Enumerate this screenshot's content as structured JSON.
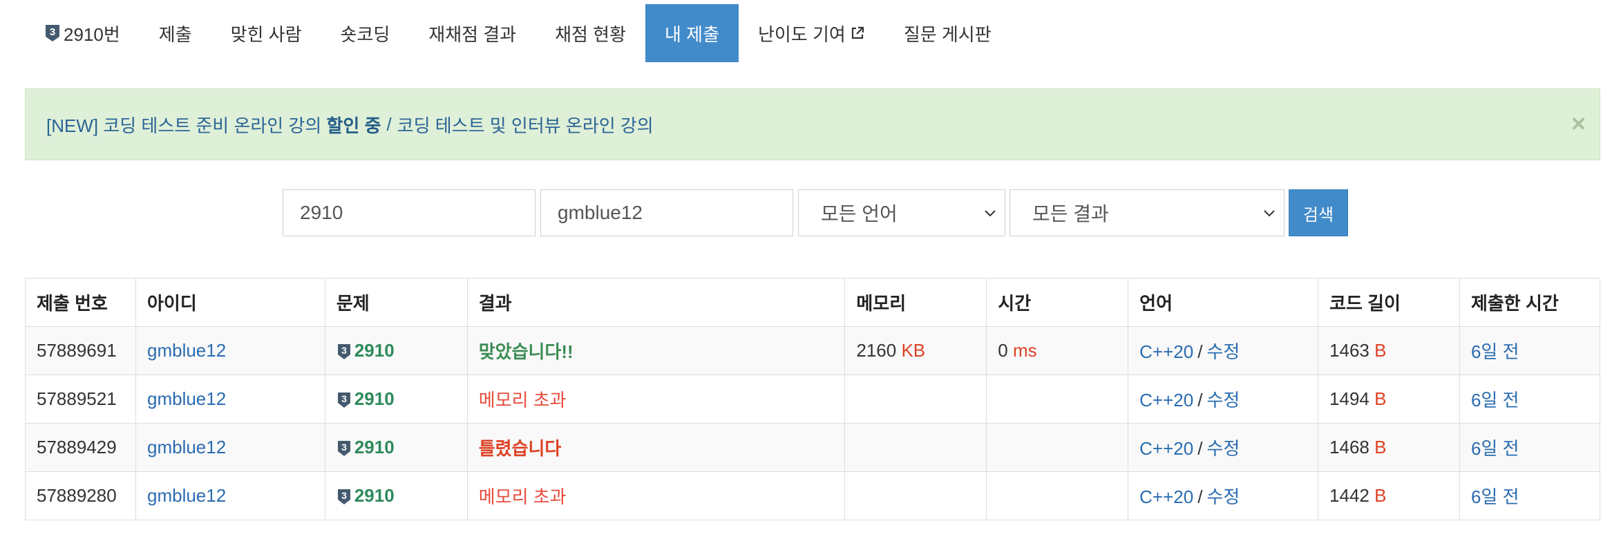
{
  "nav": {
    "problem_label": "2910번",
    "tier_badge": "3",
    "items": [
      {
        "label": "제출"
      },
      {
        "label": "맞힌 사람"
      },
      {
        "label": "숏코딩"
      },
      {
        "label": "재채점 결과"
      },
      {
        "label": "채점 현황"
      },
      {
        "label": "내 제출"
      },
      {
        "label": "난이도 기여"
      },
      {
        "label": "질문 게시판"
      }
    ],
    "active_index": 5
  },
  "alert": {
    "part1": "[NEW] 코딩 테스트 준비 온라인 강의",
    "part1_bold": "할인 중",
    "separator": "/",
    "part2": "코딩 테스트 및 인터뷰 온라인 강의",
    "close": "×"
  },
  "search": {
    "problem_value": "2910",
    "user_value": "gmblue12",
    "language_selected": "모든 언어",
    "result_selected": "모든 결과",
    "button_label": "검색"
  },
  "table": {
    "headers": [
      "제출 번호",
      "아이디",
      "문제",
      "결과",
      "메모리",
      "시간",
      "언어",
      "코드 길이",
      "제출한 시간"
    ],
    "rows": [
      {
        "id": "57889691",
        "user": "gmblue12",
        "tier": "3",
        "problem": "2910",
        "result": "맞았습니다!!",
        "memory": "2160",
        "memory_unit": "KB",
        "time": "0",
        "time_unit": "ms",
        "lang": "C++20",
        "lang_sep": "/",
        "edit": "수정",
        "length": "1463",
        "length_unit": "B",
        "submitted": "6일 전"
      },
      {
        "id": "57889521",
        "user": "gmblue12",
        "tier": "3",
        "problem": "2910",
        "result": "메모리 초과",
        "memory": "",
        "memory_unit": "",
        "time": "",
        "time_unit": "",
        "lang": "C++20",
        "lang_sep": "/",
        "edit": "수정",
        "length": "1494",
        "length_unit": "B",
        "submitted": "6일 전"
      },
      {
        "id": "57889429",
        "user": "gmblue12",
        "tier": "3",
        "problem": "2910",
        "result": "틀렸습니다",
        "memory": "",
        "memory_unit": "",
        "time": "",
        "time_unit": "",
        "lang": "C++20",
        "lang_sep": "/",
        "edit": "수정",
        "length": "1468",
        "length_unit": "B",
        "submitted": "6일 전"
      },
      {
        "id": "57889280",
        "user": "gmblue12",
        "tier": "3",
        "problem": "2910",
        "result": "메모리 초과",
        "memory": "",
        "memory_unit": "",
        "time": "",
        "time_unit": "",
        "lang": "C++20",
        "lang_sep": "/",
        "edit": "수정",
        "length": "1442",
        "length_unit": "B",
        "submitted": "6일 전"
      }
    ]
  },
  "colors": {
    "accent": "#428bca",
    "alert_bg": "#dff0d8",
    "link": "#2a6bb0",
    "accepted": "#3c8c55",
    "error": "#e74c3c",
    "problem_green": "#2e8a5c"
  },
  "icons": {
    "tier_badge": "gold-tier-badge-icon",
    "external": "external-link-icon",
    "chevron": "chevron-down-icon",
    "close": "close-icon"
  }
}
